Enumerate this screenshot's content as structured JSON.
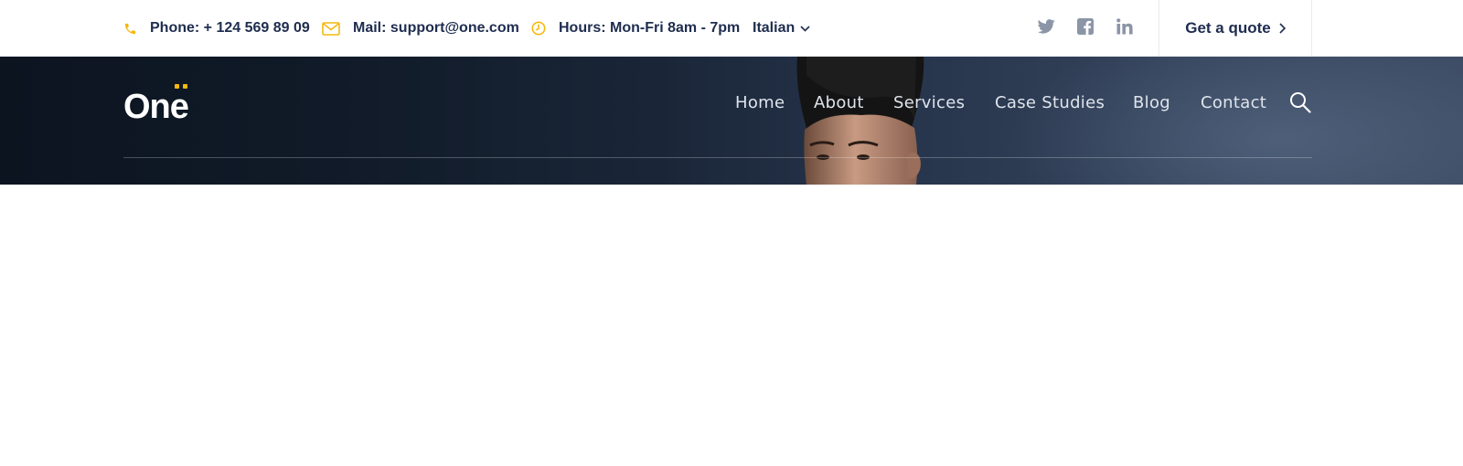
{
  "topbar": {
    "phone": "Phone: + 124 569 89 09",
    "mail": "Mail: support@one.com",
    "hours": "Hours: Mon-Fri 8am - 7pm",
    "language": "Italian",
    "quote_label": "Get a quote",
    "icons": {
      "phone": "phone-icon",
      "mail": "envelope-icon",
      "hours": "clock-icon",
      "language_chevron": "chevron-down-icon",
      "quote_chevron": "chevron-right-icon"
    },
    "social": [
      "twitter-icon",
      "facebook-icon",
      "linkedin-icon"
    ]
  },
  "header": {
    "logo": "One",
    "nav": [
      "Home",
      "About",
      "Services",
      "Case Studies",
      "Blog",
      "Contact"
    ],
    "search_icon": "search-icon"
  },
  "colors": {
    "accent": "#f5b80e",
    "text_dark": "#1e2c4f",
    "icon_gray": "#8b95a7",
    "nav_text": "#dfe4ec"
  }
}
